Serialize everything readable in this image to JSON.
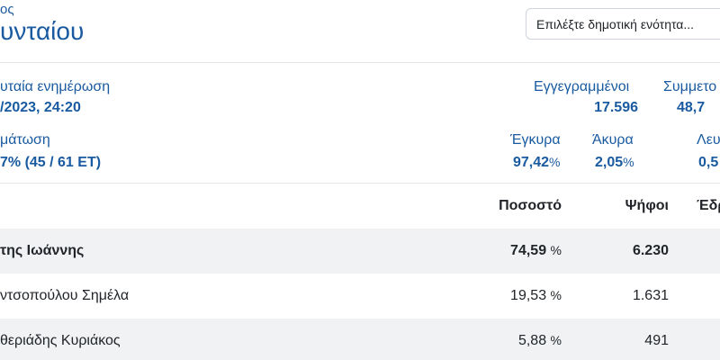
{
  "header": {
    "overline": "ος",
    "title": "υνταίου",
    "select_placeholder": "Επιλέξτε δημοτική ενότητα..."
  },
  "stats": {
    "last_update_label": "υταία ενημέρωση",
    "last_update_value": "/2023, 24:20",
    "registered_label": "Εγγεγραμμένοι",
    "registered_value": "17.596",
    "participation_label": "Συμμετο",
    "participation_value": "48,7",
    "counting_label": "μάτωση",
    "counting_value": "7% (45 / 61 ΕΤ)",
    "valid_label": "Έγκυρα",
    "valid_value": "97,42",
    "invalid_label": "Άκυρα",
    "invalid_value": "2,05",
    "blank_label": "Λευ",
    "blank_value": "0,5",
    "pct_sign": "%"
  },
  "table": {
    "headers": {
      "percent": "Ποσοστό",
      "votes": "Ψήφοι",
      "seats": "Έδρ"
    },
    "rows": [
      {
        "name": "της Ιωάννης",
        "percent": "74,59",
        "votes": "6.230"
      },
      {
        "name": "ντσοπούλου Σημέλα",
        "percent": "19,53",
        "votes": "1.631"
      },
      {
        "name": "θεριάδης Κυριάκος",
        "percent": "5,88",
        "votes": "491"
      }
    ],
    "pct_unit": "%"
  }
}
